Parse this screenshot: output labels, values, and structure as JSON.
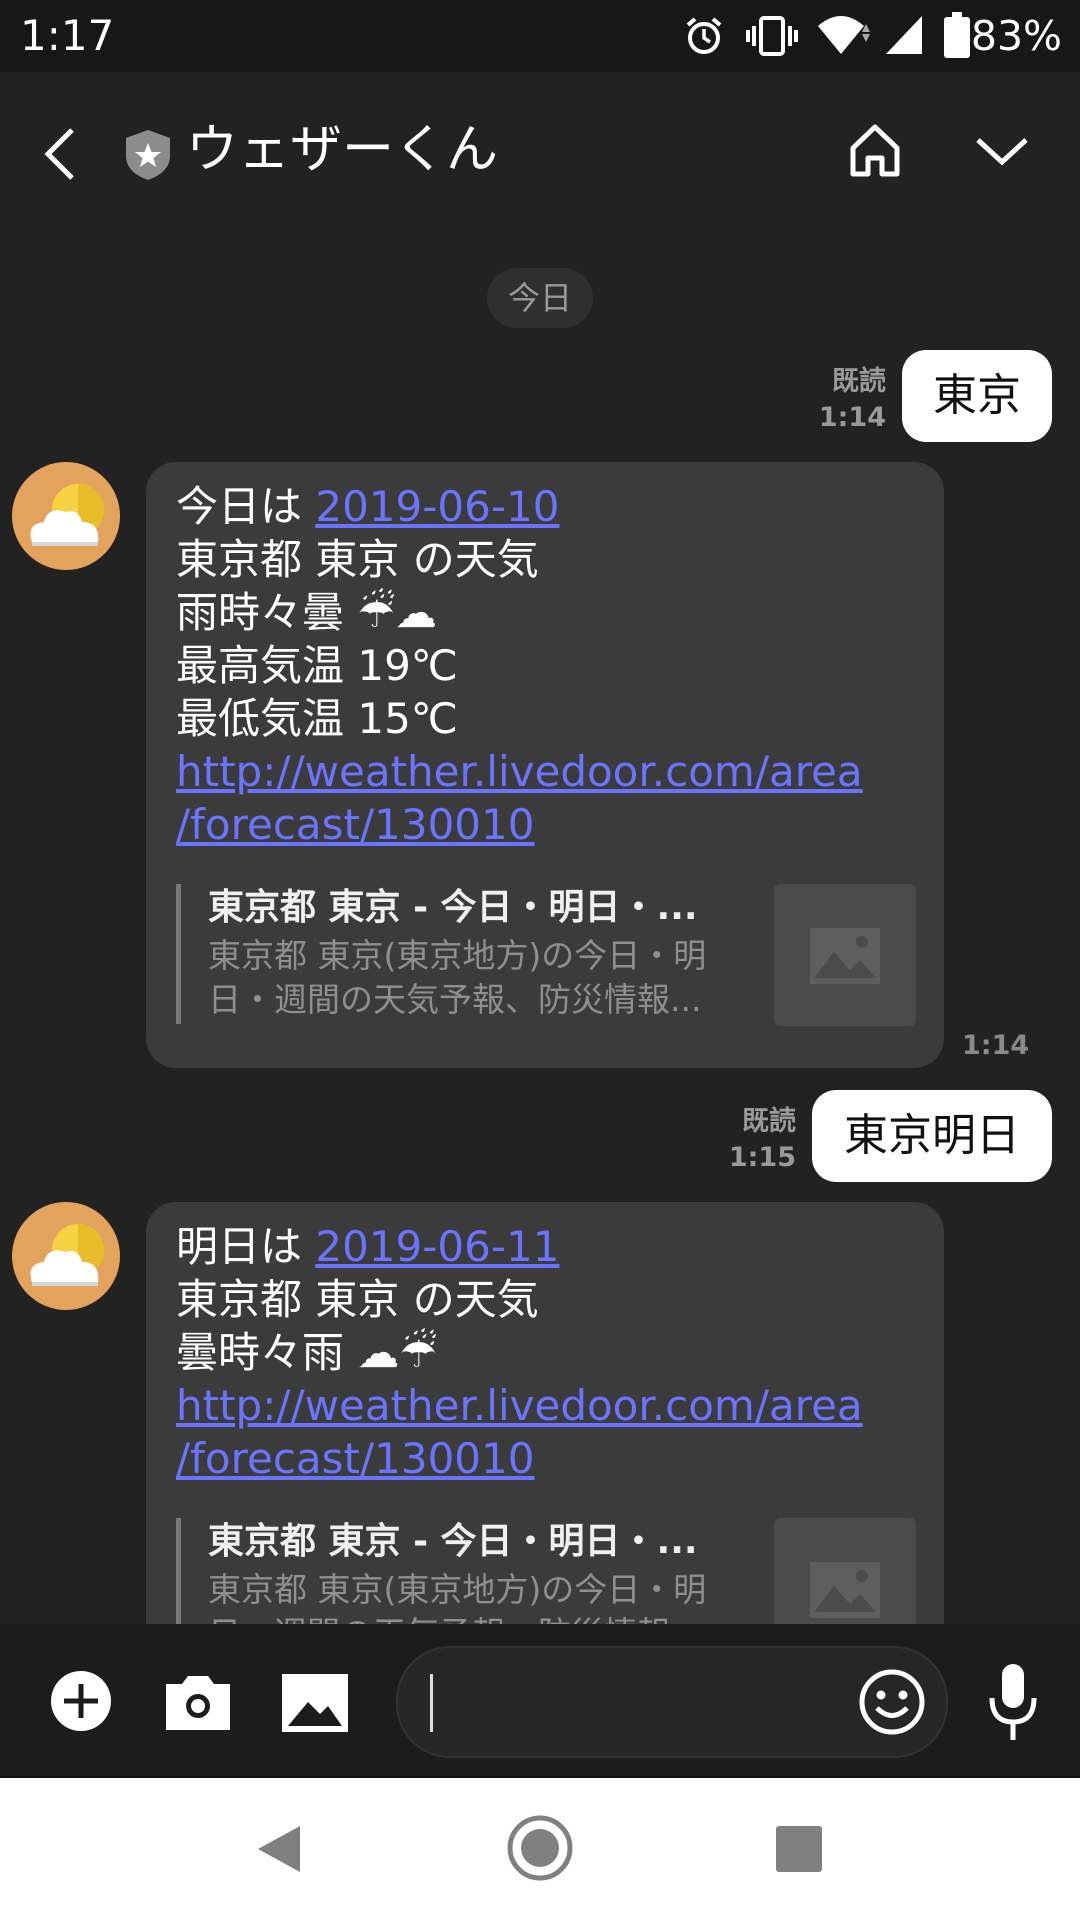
{
  "status_bar": {
    "time": "1:17",
    "battery_percent": "83%",
    "icons": [
      "alarm-icon",
      "vibrate-icon",
      "wifi-icon",
      "signal-icon",
      "battery-icon"
    ]
  },
  "header": {
    "title": "ウェザーくん",
    "icons": [
      "back-icon",
      "official-badge-icon",
      "home-icon",
      "chevron-down-icon"
    ]
  },
  "date_separator": "今日",
  "messages": [
    {
      "type": "outgoing",
      "text": "東京",
      "read_label": "既読",
      "time": "1:14"
    },
    {
      "type": "incoming",
      "lines": [
        {
          "prefix": "今日は ",
          "link": "2019-06-10"
        },
        {
          "text": "東京都 東京 の天気"
        },
        {
          "text": "雨時々曇 ☔☁"
        },
        {
          "text": "最高気温 19℃"
        },
        {
          "text": "最低気温 15℃"
        },
        {
          "link": "http://weather.livedoor.com/area"
        },
        {
          "link": "/forecast/130010"
        }
      ],
      "preview": {
        "title": "東京都 東京 - 今日・明日・...",
        "description_line1": "東京都 東京(東京地方)の今日・明",
        "description_line2": "日・週間の天気予報、防災情報..."
      },
      "time": "1:14"
    },
    {
      "type": "outgoing",
      "text": "東京明日",
      "read_label": "既読",
      "time": "1:15"
    },
    {
      "type": "incoming",
      "lines": [
        {
          "prefix": "明日は ",
          "link": "2019-06-11"
        },
        {
          "text": "東京都 東京 の天気"
        },
        {
          "text": "曇時々雨 ☁☔"
        },
        {
          "link": "http://weather.livedoor.com/area"
        },
        {
          "link": "/forecast/130010"
        }
      ],
      "preview": {
        "title": "東京都 東京 - 今日・明日・...",
        "description_line1": "東京都 東京(東京地方)の今日・明",
        "description_line2": "日・週間の天気予報、防災情報..."
      }
    }
  ],
  "composer": {
    "input_value": "",
    "icons": [
      "plus-icon",
      "camera-icon",
      "image-icon",
      "emoji-icon",
      "mic-icon"
    ]
  },
  "nav_bar": {
    "icons": [
      "nav-back-icon",
      "nav-home-icon",
      "nav-recents-icon"
    ]
  }
}
